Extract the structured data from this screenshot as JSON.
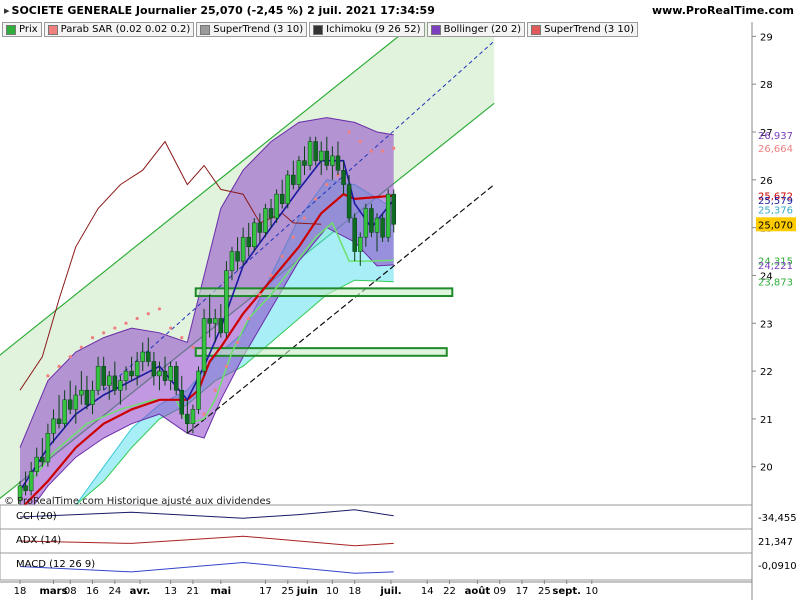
{
  "header": {
    "title": "SOCIETE GENERALE Journalier 25,070 (-2,45 %) 2 juil. 2021 17:34:59",
    "site": "www.ProRealTime.com"
  },
  "legend": [
    {
      "label": "Prix",
      "color": "#2fae3a"
    },
    {
      "label": "Parab SAR (0.02 0.02 0.2)",
      "color": "#f08080"
    },
    {
      "label": "SuperTrend (3 10)",
      "color": "#9a9a9a"
    },
    {
      "label": "Ichimoku (9 26 52)",
      "color": "#333333"
    },
    {
      "label": "Bollinger (20 2)",
      "color": "#7b3fbf"
    },
    {
      "label": "SuperTrend (3 10)",
      "color": "#e05a5a"
    }
  ],
  "copyright": "© ProRealTime.com Historique ajusté aux dividendes",
  "colors": {
    "bull": "#35c43f",
    "bear": "#0d6b22",
    "tenkan": "#1a1aa0",
    "kijun": "#cc0000",
    "chikou": "#8b1a1a",
    "bollinger": "#8e44c9",
    "kumo_up": "#5fe0ee",
    "kumo_down": "#7fa6ee",
    "sar": "#f08080",
    "supertrend": "#6ee06e",
    "channel": "#2fae3a"
  },
  "chart_data": {
    "type": "candlestick",
    "instrument": "SOCIETE GENERALE",
    "timeframe": "Journalier",
    "y_range": [
      19.2,
      29.3
    ],
    "x_range_days": [
      0,
      166
    ],
    "yticks": [
      20,
      21,
      22,
      23,
      24,
      25,
      26,
      27,
      28,
      29
    ],
    "xticks": [
      {
        "label": "18",
        "day": 0
      },
      {
        "label": "mars",
        "day": 12,
        "bold": true
      },
      {
        "label": "08",
        "day": 18
      },
      {
        "label": "16",
        "day": 26
      },
      {
        "label": "24",
        "day": 34
      },
      {
        "label": "avr.",
        "day": 43,
        "bold": true
      },
      {
        "label": "13",
        "day": 54
      },
      {
        "label": "21",
        "day": 62
      },
      {
        "label": "mai",
        "day": 72,
        "bold": true
      },
      {
        "label": "17",
        "day": 88
      },
      {
        "label": "25",
        "day": 96
      },
      {
        "label": "juin",
        "day": 103,
        "bold": true
      },
      {
        "label": "10",
        "day": 112
      },
      {
        "label": "18",
        "day": 120
      },
      {
        "label": "juil.",
        "day": 133,
        "bold": true
      },
      {
        "label": "14",
        "day": 146
      },
      {
        "label": "22",
        "day": 154
      },
      {
        "label": "août",
        "day": 164,
        "bold": true
      },
      {
        "label": "09",
        "day": 172
      },
      {
        "label": "17",
        "day": 180
      },
      {
        "label": "25",
        "day": 188
      },
      {
        "label": "sept.",
        "day": 196,
        "bold": true
      },
      {
        "label": "10",
        "day": 205
      }
    ],
    "price_labels": [
      {
        "value": "26,937",
        "price": 26.937,
        "color": "#7b3fbf"
      },
      {
        "value": "26,664",
        "price": 26.664,
        "color": "#f08080"
      },
      {
        "value": "25,672",
        "price": 25.672,
        "color": "#cc0000"
      },
      {
        "value": "25,579",
        "price": 25.579,
        "color": "#1a1aa0"
      },
      {
        "value": "25,376",
        "price": 25.376,
        "color": "#3aa9c9"
      },
      {
        "value": "25,070",
        "price": 25.07,
        "color": "#000000",
        "highlight": true
      },
      {
        "value": "24,315",
        "price": 24.315,
        "color": "#2fae3a"
      },
      {
        "value": "24,221",
        "price": 24.221,
        "color": "#7b3fbf"
      },
      {
        "value": "23,873",
        "price": 23.873,
        "color": "#2fae3a"
      }
    ],
    "candles": [
      {
        "d": 0,
        "o": 19.3,
        "h": 19.7,
        "l": 19.2,
        "c": 19.6
      },
      {
        "d": 2,
        "o": 19.6,
        "h": 19.9,
        "l": 19.4,
        "c": 19.5
      },
      {
        "d": 4,
        "o": 19.5,
        "h": 20.1,
        "l": 19.4,
        "c": 19.9
      },
      {
        "d": 6,
        "o": 19.9,
        "h": 20.4,
        "l": 19.8,
        "c": 20.2
      },
      {
        "d": 8,
        "o": 20.2,
        "h": 20.6,
        "l": 20.0,
        "c": 20.1
      },
      {
        "d": 10,
        "o": 20.1,
        "h": 20.9,
        "l": 20.0,
        "c": 20.7
      },
      {
        "d": 12,
        "o": 20.7,
        "h": 21.2,
        "l": 20.5,
        "c": 21.0
      },
      {
        "d": 14,
        "o": 21.0,
        "h": 21.5,
        "l": 20.8,
        "c": 20.9
      },
      {
        "d": 16,
        "o": 20.9,
        "h": 21.6,
        "l": 20.8,
        "c": 21.4
      },
      {
        "d": 18,
        "o": 21.4,
        "h": 21.8,
        "l": 21.1,
        "c": 21.2
      },
      {
        "d": 20,
        "o": 21.2,
        "h": 21.7,
        "l": 20.9,
        "c": 21.5
      },
      {
        "d": 22,
        "o": 21.5,
        "h": 22.0,
        "l": 21.3,
        "c": 21.6
      },
      {
        "d": 24,
        "o": 21.6,
        "h": 21.9,
        "l": 21.2,
        "c": 21.3
      },
      {
        "d": 26,
        "o": 21.3,
        "h": 21.8,
        "l": 21.1,
        "c": 21.6
      },
      {
        "d": 28,
        "o": 21.6,
        "h": 22.3,
        "l": 21.5,
        "c": 22.1
      },
      {
        "d": 30,
        "o": 22.1,
        "h": 22.3,
        "l": 21.6,
        "c": 21.7
      },
      {
        "d": 32,
        "o": 21.7,
        "h": 22.0,
        "l": 21.4,
        "c": 21.9
      },
      {
        "d": 34,
        "o": 21.9,
        "h": 22.2,
        "l": 21.5,
        "c": 21.6
      },
      {
        "d": 36,
        "o": 21.6,
        "h": 21.9,
        "l": 21.3,
        "c": 21.8
      },
      {
        "d": 38,
        "o": 21.8,
        "h": 22.1,
        "l": 21.6,
        "c": 22.0
      },
      {
        "d": 40,
        "o": 22.0,
        "h": 22.3,
        "l": 21.8,
        "c": 21.9
      },
      {
        "d": 42,
        "o": 21.9,
        "h": 22.4,
        "l": 21.7,
        "c": 22.2
      },
      {
        "d": 44,
        "o": 22.2,
        "h": 22.6,
        "l": 22.0,
        "c": 22.4
      },
      {
        "d": 46,
        "o": 22.4,
        "h": 22.7,
        "l": 22.1,
        "c": 22.2
      },
      {
        "d": 48,
        "o": 22.2,
        "h": 22.4,
        "l": 21.7,
        "c": 21.9
      },
      {
        "d": 50,
        "o": 21.9,
        "h": 22.2,
        "l": 21.6,
        "c": 22.0
      },
      {
        "d": 52,
        "o": 22.0,
        "h": 22.3,
        "l": 21.7,
        "c": 21.8
      },
      {
        "d": 54,
        "o": 21.8,
        "h": 22.2,
        "l": 21.6,
        "c": 22.1
      },
      {
        "d": 56,
        "o": 22.1,
        "h": 22.2,
        "l": 21.5,
        "c": 21.6
      },
      {
        "d": 58,
        "o": 21.6,
        "h": 21.9,
        "l": 21.0,
        "c": 21.1
      },
      {
        "d": 60,
        "o": 21.1,
        "h": 21.4,
        "l": 20.7,
        "c": 20.9
      },
      {
        "d": 62,
        "o": 20.9,
        "h": 21.3,
        "l": 20.7,
        "c": 21.2
      },
      {
        "d": 64,
        "o": 21.2,
        "h": 22.1,
        "l": 21.1,
        "c": 22.0
      },
      {
        "d": 66,
        "o": 22.0,
        "h": 23.3,
        "l": 21.9,
        "c": 23.1
      },
      {
        "d": 68,
        "o": 23.1,
        "h": 23.6,
        "l": 22.7,
        "c": 23.0
      },
      {
        "d": 70,
        "o": 23.0,
        "h": 23.3,
        "l": 22.6,
        "c": 23.1
      },
      {
        "d": 72,
        "o": 23.1,
        "h": 23.4,
        "l": 22.7,
        "c": 22.8
      },
      {
        "d": 74,
        "o": 22.8,
        "h": 24.3,
        "l": 22.7,
        "c": 24.1
      },
      {
        "d": 76,
        "o": 24.1,
        "h": 24.6,
        "l": 23.9,
        "c": 24.5
      },
      {
        "d": 78,
        "o": 24.5,
        "h": 24.8,
        "l": 24.1,
        "c": 24.3
      },
      {
        "d": 80,
        "o": 24.3,
        "h": 25.0,
        "l": 24.2,
        "c": 24.8
      },
      {
        "d": 82,
        "o": 24.8,
        "h": 25.1,
        "l": 24.4,
        "c": 24.6
      },
      {
        "d": 84,
        "o": 24.6,
        "h": 25.2,
        "l": 24.5,
        "c": 25.1
      },
      {
        "d": 86,
        "o": 25.1,
        "h": 25.3,
        "l": 24.7,
        "c": 24.9
      },
      {
        "d": 88,
        "o": 24.9,
        "h": 25.5,
        "l": 24.8,
        "c": 25.4
      },
      {
        "d": 90,
        "o": 25.4,
        "h": 25.6,
        "l": 25.0,
        "c": 25.2
      },
      {
        "d": 92,
        "o": 25.2,
        "h": 25.8,
        "l": 25.1,
        "c": 25.7
      },
      {
        "d": 94,
        "o": 25.7,
        "h": 26.0,
        "l": 25.4,
        "c": 25.5
      },
      {
        "d": 96,
        "o": 25.5,
        "h": 26.2,
        "l": 25.4,
        "c": 26.1
      },
      {
        "d": 98,
        "o": 26.1,
        "h": 26.4,
        "l": 25.8,
        "c": 25.9
      },
      {
        "d": 100,
        "o": 25.9,
        "h": 26.5,
        "l": 25.8,
        "c": 26.4
      },
      {
        "d": 102,
        "o": 26.4,
        "h": 26.7,
        "l": 26.1,
        "c": 26.3
      },
      {
        "d": 104,
        "o": 26.3,
        "h": 26.9,
        "l": 26.2,
        "c": 26.8
      },
      {
        "d": 106,
        "o": 26.8,
        "h": 26.9,
        "l": 26.3,
        "c": 26.4
      },
      {
        "d": 108,
        "o": 26.4,
        "h": 26.8,
        "l": 26.1,
        "c": 26.6
      },
      {
        "d": 110,
        "o": 26.6,
        "h": 26.9,
        "l": 26.2,
        "c": 26.3
      },
      {
        "d": 112,
        "o": 26.3,
        "h": 26.7,
        "l": 26.0,
        "c": 26.5
      },
      {
        "d": 114,
        "o": 26.5,
        "h": 26.8,
        "l": 26.1,
        "c": 26.2
      },
      {
        "d": 116,
        "o": 26.2,
        "h": 26.4,
        "l": 25.7,
        "c": 25.9
      },
      {
        "d": 118,
        "o": 25.9,
        "h": 26.1,
        "l": 25.1,
        "c": 25.2
      },
      {
        "d": 120,
        "o": 25.2,
        "h": 25.3,
        "l": 24.3,
        "c": 24.5
      },
      {
        "d": 122,
        "o": 24.5,
        "h": 24.9,
        "l": 24.2,
        "c": 24.8
      },
      {
        "d": 124,
        "o": 24.8,
        "h": 25.5,
        "l": 24.6,
        "c": 25.4
      },
      {
        "d": 126,
        "o": 25.4,
        "h": 25.5,
        "l": 24.8,
        "c": 24.9
      },
      {
        "d": 128,
        "o": 24.9,
        "h": 25.3,
        "l": 24.5,
        "c": 25.2
      },
      {
        "d": 130,
        "o": 25.2,
        "h": 25.3,
        "l": 24.7,
        "c": 24.8
      },
      {
        "d": 132,
        "o": 24.8,
        "h": 25.8,
        "l": 24.7,
        "c": 25.7
      },
      {
        "d": 134,
        "o": 25.7,
        "h": 25.8,
        "l": 24.9,
        "c": 25.07
      }
    ],
    "bollinger_upper": [
      [
        0,
        20.4
      ],
      [
        10,
        21.8
      ],
      [
        20,
        22.4
      ],
      [
        30,
        22.7
      ],
      [
        40,
        22.9
      ],
      [
        50,
        22.8
      ],
      [
        60,
        22.6
      ],
      [
        66,
        24.0
      ],
      [
        72,
        25.4
      ],
      [
        80,
        26.2
      ],
      [
        90,
        26.8
      ],
      [
        100,
        27.2
      ],
      [
        110,
        27.3
      ],
      [
        120,
        27.2
      ],
      [
        128,
        27.0
      ],
      [
        134,
        26.94
      ]
    ],
    "bollinger_lower": [
      [
        0,
        18.8
      ],
      [
        10,
        19.6
      ],
      [
        20,
        20.2
      ],
      [
        30,
        20.6
      ],
      [
        40,
        20.9
      ],
      [
        50,
        21.1
      ],
      [
        60,
        20.7
      ],
      [
        66,
        20.6
      ],
      [
        72,
        21.4
      ],
      [
        80,
        22.3
      ],
      [
        90,
        23.3
      ],
      [
        100,
        24.3
      ],
      [
        110,
        25.0
      ],
      [
        120,
        24.7
      ],
      [
        128,
        24.2
      ],
      [
        134,
        24.22
      ]
    ],
    "tenkan": [
      [
        0,
        19.5
      ],
      [
        10,
        20.4
      ],
      [
        20,
        21.1
      ],
      [
        30,
        21.5
      ],
      [
        40,
        21.8
      ],
      [
        50,
        22.1
      ],
      [
        60,
        21.4
      ],
      [
        66,
        22.1
      ],
      [
        72,
        22.9
      ],
      [
        80,
        24.2
      ],
      [
        90,
        25.0
      ],
      [
        100,
        25.8
      ],
      [
        108,
        26.4
      ],
      [
        116,
        26.4
      ],
      [
        120,
        25.5
      ],
      [
        126,
        25.0
      ],
      [
        134,
        25.58
      ]
    ],
    "kijun": [
      [
        0,
        19.1
      ],
      [
        10,
        19.7
      ],
      [
        20,
        20.4
      ],
      [
        30,
        20.9
      ],
      [
        40,
        21.2
      ],
      [
        50,
        21.4
      ],
      [
        60,
        21.4
      ],
      [
        64,
        21.6
      ],
      [
        68,
        22.2
      ],
      [
        72,
        22.5
      ],
      [
        80,
        23.2
      ],
      [
        90,
        23.9
      ],
      [
        100,
        24.6
      ],
      [
        108,
        25.3
      ],
      [
        116,
        25.7
      ],
      [
        120,
        25.6
      ],
      [
        134,
        25.67
      ]
    ],
    "chikou": [
      [
        0,
        21.6
      ],
      [
        8,
        22.3
      ],
      [
        14,
        23.5
      ],
      [
        20,
        24.6
      ],
      [
        28,
        25.4
      ],
      [
        36,
        25.9
      ],
      [
        44,
        26.2
      ],
      [
        52,
        26.8
      ],
      [
        60,
        25.9
      ],
      [
        66,
        26.3
      ],
      [
        72,
        25.8
      ],
      [
        80,
        25.7
      ],
      [
        86,
        25.1
      ],
      [
        94,
        25.3
      ],
      [
        98,
        25.1
      ],
      [
        108,
        25.07
      ]
    ],
    "kumo_a": [
      [
        20,
        19.2
      ],
      [
        30,
        20.0
      ],
      [
        40,
        20.8
      ],
      [
        50,
        21.3
      ],
      [
        60,
        21.6
      ],
      [
        70,
        22.3
      ],
      [
        80,
        22.8
      ],
      [
        90,
        24.0
      ],
      [
        100,
        25.2
      ],
      [
        110,
        26.0
      ],
      [
        120,
        25.9
      ],
      [
        134,
        25.4
      ]
    ],
    "kumo_b": [
      [
        20,
        19.2
      ],
      [
        30,
        19.7
      ],
      [
        40,
        20.4
      ],
      [
        50,
        21.0
      ],
      [
        60,
        21.3
      ],
      [
        70,
        21.8
      ],
      [
        80,
        22.1
      ],
      [
        90,
        22.6
      ],
      [
        100,
        23.1
      ],
      [
        110,
        23.6
      ],
      [
        120,
        23.9
      ],
      [
        134,
        23.87
      ]
    ],
    "sar_points": [
      [
        10,
        21.9
      ],
      [
        14,
        22.1
      ],
      [
        18,
        22.3
      ],
      [
        22,
        22.5
      ],
      [
        26,
        22.7
      ],
      [
        30,
        22.8
      ],
      [
        34,
        22.9
      ],
      [
        38,
        23.0
      ],
      [
        42,
        23.1
      ],
      [
        46,
        23.2
      ],
      [
        50,
        23.3
      ],
      [
        54,
        22.9
      ],
      [
        58,
        22.7
      ],
      [
        62,
        22.5
      ],
      [
        66,
        21.1
      ],
      [
        70,
        21.6
      ],
      [
        74,
        22.1
      ],
      [
        78,
        22.6
      ],
      [
        82,
        23.1
      ],
      [
        86,
        23.6
      ],
      [
        90,
        24.0
      ],
      [
        94,
        24.4
      ],
      [
        98,
        24.8
      ],
      [
        102,
        25.2
      ],
      [
        106,
        25.6
      ],
      [
        110,
        25.9
      ],
      [
        114,
        26.1
      ],
      [
        118,
        27.0
      ],
      [
        122,
        26.8
      ],
      [
        126,
        26.6
      ],
      [
        130,
        26.6
      ],
      [
        134,
        26.66
      ]
    ],
    "supertrend": [
      [
        0,
        19.4
      ],
      [
        12,
        20.3
      ],
      [
        24,
        20.9
      ],
      [
        36,
        21.2
      ],
      [
        48,
        21.4
      ],
      [
        56,
        21.4
      ],
      [
        60,
        20.9
      ],
      [
        66,
        21.0
      ],
      [
        70,
        21.4
      ],
      [
        76,
        22.4
      ],
      [
        82,
        23.1
      ],
      [
        90,
        23.6
      ],
      [
        98,
        24.2
      ],
      [
        106,
        24.8
      ],
      [
        112,
        25.1
      ],
      [
        118,
        24.3
      ],
      [
        126,
        24.3
      ],
      [
        134,
        24.32
      ]
    ],
    "channel_upper": [
      [
        -8,
        22.3
      ],
      [
        170,
        30.6
      ]
    ],
    "channel_lower": [
      [
        -8,
        19.3
      ],
      [
        170,
        27.6
      ]
    ],
    "channel_mid": [
      [
        30,
        21.6
      ],
      [
        170,
        28.9
      ]
    ],
    "support_line": [
      [
        60,
        20.7
      ],
      [
        170,
        25.9
      ]
    ],
    "support_zones": [
      {
        "from_day": 63,
        "to_day": 155,
        "top": 23.73,
        "bottom": 23.57
      },
      {
        "from_day": 63,
        "to_day": 153,
        "top": 22.48,
        "bottom": 22.32
      }
    ]
  },
  "indicators": [
    {
      "name": "CCI (20)",
      "value": "-34,455"
    },
    {
      "name": "ADX (14)",
      "value": "21,347"
    },
    {
      "name": "MACD (12 26 9)",
      "value": "-0,0910"
    }
  ]
}
